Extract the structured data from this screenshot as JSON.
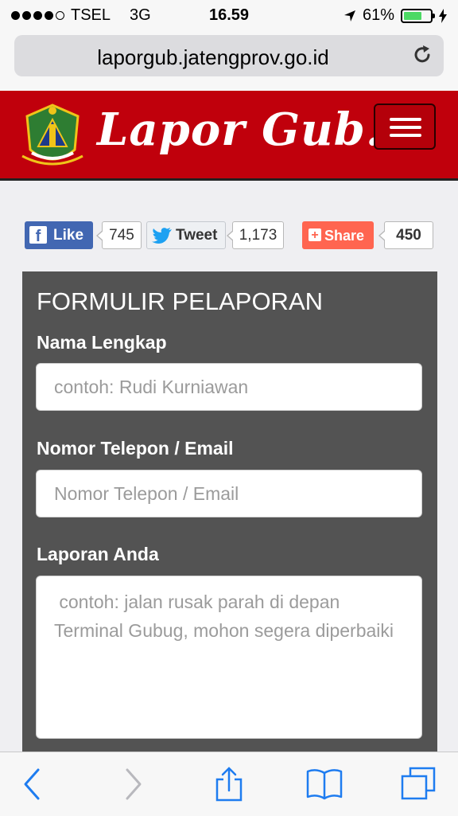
{
  "status_bar": {
    "carrier": "TSEL",
    "network": "3G",
    "time": "16.59",
    "battery_text": "61%",
    "battery_level": 0.61,
    "signal_bars_filled": 4,
    "signal_bars_total": 5,
    "icons": [
      "location-arrow-icon",
      "battery-icon",
      "charging-icon"
    ]
  },
  "browser": {
    "url": "laporgub.jatengprov.go.id",
    "icons": [
      "reload-icon"
    ],
    "toolbar_icons": [
      "back-icon",
      "forward-icon",
      "share-icon",
      "bookmarks-icon",
      "tabs-icon"
    ]
  },
  "header": {
    "brand": "Lapor Gub..!",
    "logo": "jateng-emblem",
    "menu_icon": "hamburger-icon",
    "brand_color": "#c0000c"
  },
  "social": {
    "facebook": {
      "label": "Like",
      "count": "745",
      "color": "#4267b2"
    },
    "twitter": {
      "label": "Tweet",
      "count": "1,173"
    },
    "share": {
      "label": "Share",
      "count": "450",
      "color": "#ff6550"
    }
  },
  "form": {
    "title": "FORMULIR PELAPORAN",
    "fields": [
      {
        "label": "Nama Lengkap",
        "placeholder": "contoh: Rudi Kurniawan",
        "value": ""
      },
      {
        "label": "Nomor Telepon / Email",
        "placeholder": "Nomor Telepon / Email",
        "value": ""
      },
      {
        "label": "Laporan Anda",
        "placeholder": " contoh: jalan rusak parah di depan Terminal Gubug, mohon segera diperbaiki",
        "value": ""
      }
    ]
  }
}
